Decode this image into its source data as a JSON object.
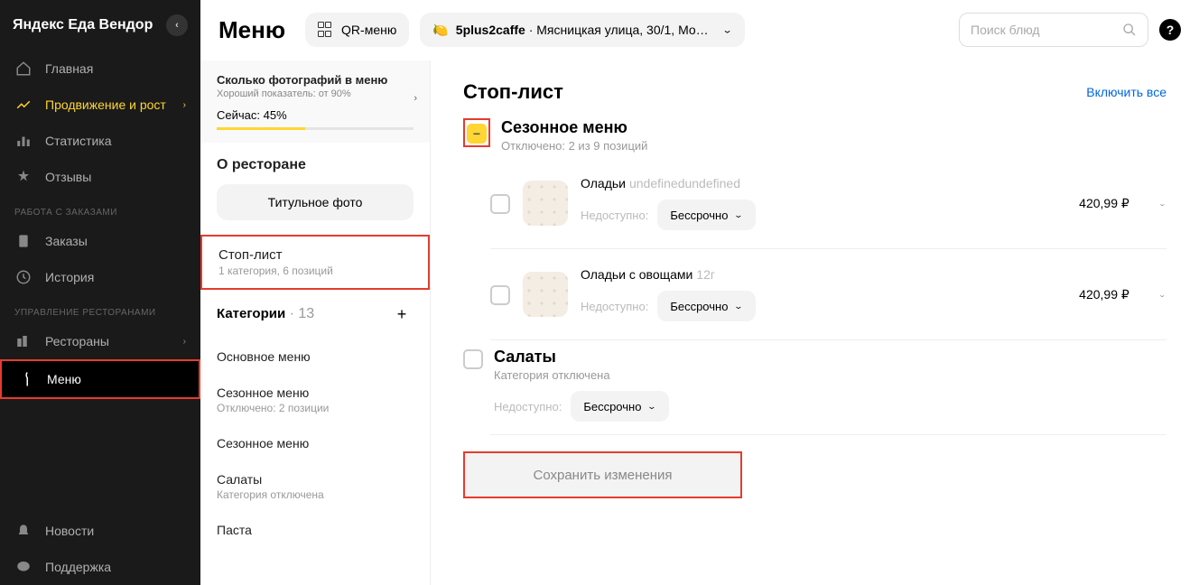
{
  "brand": "Яндекс Еда Вендор",
  "nav": {
    "main": "Главная",
    "promo": "Продвижение и рост",
    "stats": "Статистика",
    "reviews": "Отзывы",
    "section_orders": "РАБОТА С ЗАКАЗАМИ",
    "orders": "Заказы",
    "history": "История",
    "section_mgmt": "УПРАВЛЕНИЕ РЕСТОРАНАМИ",
    "restaurants": "Рестораны",
    "menu": "Меню",
    "news": "Новости",
    "support": "Поддержка"
  },
  "header": {
    "title": "Меню",
    "qr": "QR-меню",
    "venue_name": "5plus2caffe",
    "venue_addr": " · Мясницкая улица, 30/1, Москва,...",
    "search_placeholder": "Поиск блюд"
  },
  "photo": {
    "title": "Сколько фотографий в меню",
    "sub": "Хороший показатель: от 90%",
    "now": "Сейчас: 45%"
  },
  "left": {
    "about": "О ресторане",
    "title_photo": "Титульное фото",
    "stoplist": "Стоп-лист",
    "stoplist_sub": "1 категория, 6 позиций",
    "categories": "Категории",
    "cat_count": " · 13",
    "main_menu": "Основное меню",
    "seasonal": "Сезонное меню",
    "seasonal_sub": "Отключено: 2 позиции",
    "seasonal2": "Сезонное меню",
    "salads": "Салаты",
    "salads_sub": "Категория отключена",
    "pasta": "Паста"
  },
  "stop": {
    "title": "Стоп-лист",
    "enable_all": "Включить все",
    "cat1_name": "Сезонное меню",
    "cat1_sub": "Отключено: 2 из 9 позиций",
    "unavail": "Недоступно:",
    "term": "Бессрочно",
    "item1_name": "Оладьи",
    "item1_gray": "undefinedundefined",
    "item1_price": "420,99 ₽",
    "item2_name": "Оладьи с овощами",
    "item2_gray": "12г",
    "item2_price": "420,99 ₽",
    "cat2_name": "Салаты",
    "cat2_sub": "Категория отключена",
    "save": "Сохранить изменения"
  }
}
